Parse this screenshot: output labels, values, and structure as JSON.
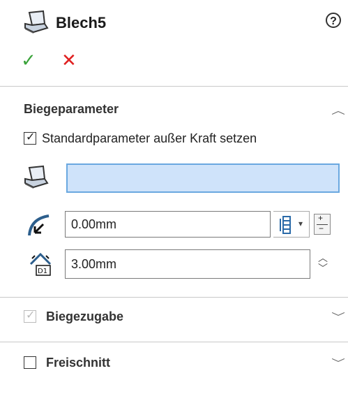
{
  "header": {
    "title": "Blech5",
    "help_icon": "question-circle-icon",
    "confirm_symbol": "✓",
    "cancel_symbol": "✕"
  },
  "colors": {
    "confirm": "#3aa33a",
    "cancel": "#e02020",
    "selection": "#cfe3fa",
    "selection_border": "#6aa8e0"
  },
  "sections": {
    "bend_parameters": {
      "title": "Biegeparameter",
      "override_label": "Standardparameter außer Kraft setzen",
      "override_checked": true,
      "face_field_value": "",
      "radius_value": "0.00mm",
      "thickness_value": "3.00mm"
    },
    "bend_allowance": {
      "title": "Biegezugabe",
      "checked": true,
      "enabled": false
    },
    "relief": {
      "title": "Freischnitt",
      "checked": false
    }
  }
}
